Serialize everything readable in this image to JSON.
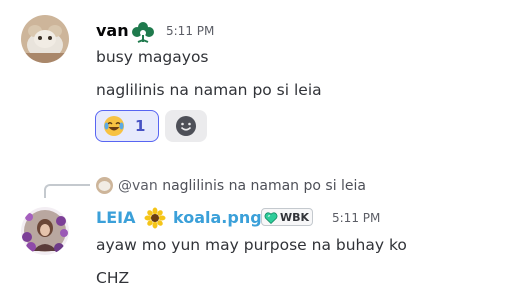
{
  "message1": {
    "author": "van",
    "timestamp": "5:11 PM",
    "lines": [
      "busy magayos",
      "naglilinis na naman po si leia"
    ]
  },
  "reactions": [
    {
      "emoji_icon": "joy-emoji-icon",
      "count": "1",
      "selected": true
    }
  ],
  "reply": {
    "author": "@van",
    "quoted_text": "naglilinis na naman po si leia"
  },
  "message2": {
    "author": "LEIA",
    "author_color": "#3ba0d9",
    "secondary_name": "koala.png",
    "tag_label": "WBK",
    "timestamp": "5:11 PM",
    "lines": [
      "ayaw mo yun may purpose na buhay ko",
      "CHZ"
    ]
  },
  "colors": {
    "accent": "#5865f2",
    "reaction_bg": "#e7eafc",
    "name_blue": "#3ba0d9",
    "text": "#313338"
  }
}
